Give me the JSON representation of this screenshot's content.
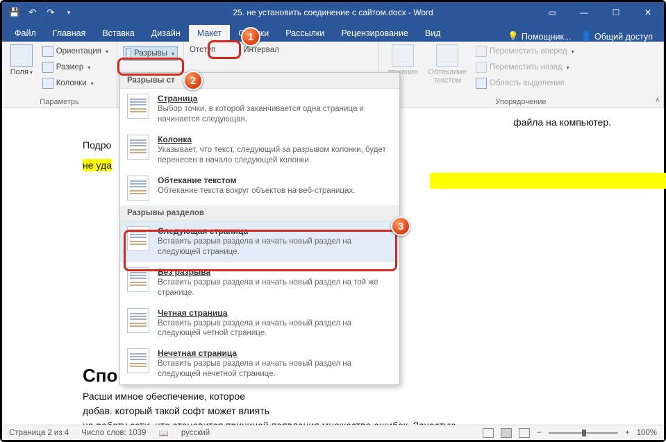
{
  "title": "25. не   установить соединение с сайтом.docx - Word",
  "tabs": [
    "Файл",
    "Главная",
    "Вставка",
    "Дизайн",
    "Макет",
    "Ссылки",
    "Рассылки",
    "Рецензирование",
    "Вид"
  ],
  "helpers": {
    "tell": "Помощник...",
    "share": "Общий доступ"
  },
  "ribbon": {
    "margins": "Поля",
    "orientation": "Ориентация",
    "size": "Размер",
    "columns": "Колонки",
    "breaks": "Разрывы",
    "indent": "Отступ",
    "spacing": "Интервал",
    "position": "ложение",
    "wrap": "Обтекание текстом",
    "forward": "Переместить вперед",
    "backward": "Переместить назад",
    "selection": "Область выделения",
    "g_page": "Параметрь",
    "g_arrange": "Упорядочение"
  },
  "dropdown": {
    "h1": "Разрывы ст",
    "h2": "Разрывы разделов",
    "items1": [
      {
        "t": "Страница",
        "d": "Выбор точки, в которой заканчивается одна страница и начинается следующая."
      },
      {
        "t": "Колонка",
        "d": "Указывает, что текст, следующий за разрывом колонки, будет перенесен в начало следующей колонки."
      },
      {
        "t": "Обтекание текстом",
        "d": "Обтекание текста вокруг объектов на веб-страницах."
      }
    ],
    "items2": [
      {
        "t": "Следующая страница",
        "d": "Вставить разрыв раздела и начать новый раздел на следующей странице."
      },
      {
        "t": "Без разрыва",
        "d": "Вставить разрыв раздела и начать новый раздел на той же странице."
      },
      {
        "t": "Четная страница",
        "d": "Вставить разрыв раздела и начать новый раздел на следующей четной странице."
      },
      {
        "t": "Нечетная страница",
        "d": "Вставить разрыв раздела и начать новый раздел на следующей нечетной странице."
      }
    ]
  },
  "doc": {
    "l0": "файла на компьютер.",
    "l1": "Подро",
    "l2": "не уда",
    "h": "Спо                                                       ний",
    "p1": "Расши                                                                                             имное обеспечение, которое",
    "p2": "добав.                                                                                             который такой софт может влиять",
    "p3": "на работу сети, что становится причиной появления множества ошибок. Зачастую"
  },
  "status": {
    "page": "Страница 2 из 4",
    "words": "Число слов: 1039",
    "lang": "русский",
    "zoom": "100%"
  },
  "badges": {
    "b1": "1",
    "b2": "2",
    "b3": "3"
  }
}
